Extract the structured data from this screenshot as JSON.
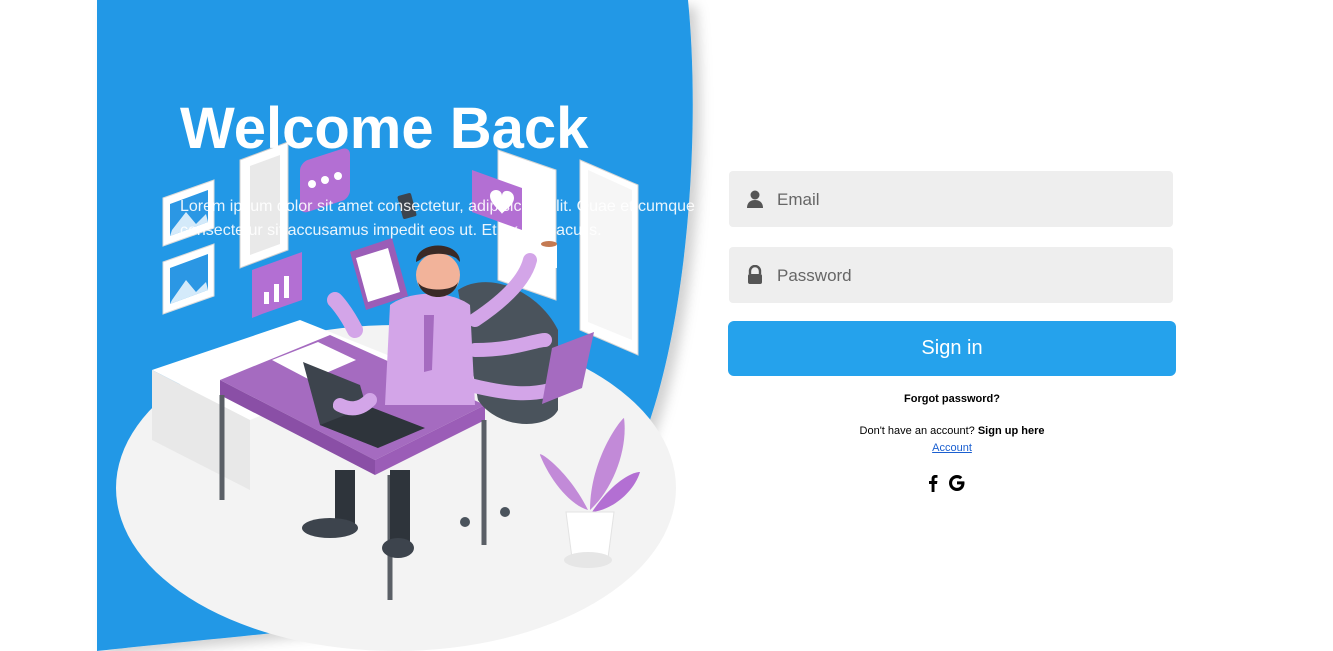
{
  "hero": {
    "title": "Welcome Back",
    "text": "Lorem ipsum dolor sit amet consectetur, adipisicing elit. Quae et cumque consectetur sit accusamus impedit eos ut. Et ex odit iaculis."
  },
  "form": {
    "email_placeholder": "Email",
    "password_placeholder": "Password",
    "signin_label": "Sign in",
    "forgot_label": "Forgot password?",
    "no_account_text": "Don't have an account?",
    "signup_label": "Sign up here",
    "account_link": "Account"
  },
  "social": {
    "icons": [
      "facebook-icon",
      "google-icon"
    ]
  },
  "colors": {
    "brand_blue": "#25a2ec",
    "field_bg": "#eeeeee",
    "accent_purple": "#a56bc0"
  }
}
